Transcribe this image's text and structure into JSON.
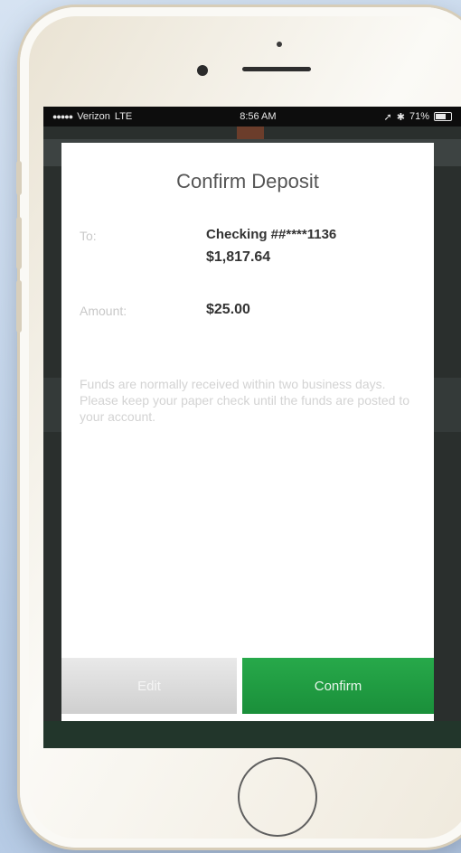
{
  "statusbar": {
    "carrier": "Verizon",
    "network": "LTE",
    "time": "8:56 AM",
    "battery": "71%"
  },
  "modal": {
    "title": "Confirm Deposit",
    "to_label": "To:",
    "to_account": "Checking ##****1136",
    "to_balance": "$1,817.64",
    "amount_label": "Amount:",
    "amount_value": "$25.00",
    "disclaimer": "Funds are normally received within two business days. Please keep your paper check until the funds are posted to your account.",
    "cancel_label": "Edit",
    "confirm_label": "Confirm"
  },
  "colors": {
    "confirm_green": "#1f9c43",
    "background": "#c9d9ec"
  }
}
